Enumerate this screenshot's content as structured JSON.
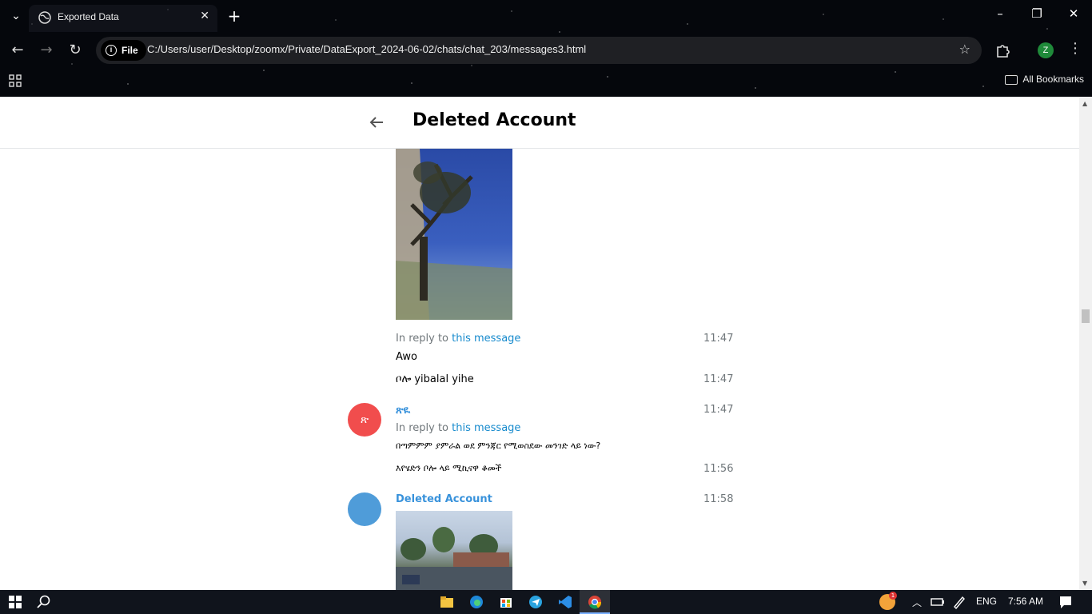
{
  "browser": {
    "tab_title": "Exported Data",
    "scheme_chip": "File",
    "url": "C:/Users/user/Desktop/zoomx/Private/DataExport_2024-06-02/chats/chat_203/messages3.html",
    "profile_initial": "Z",
    "bookmarks_label": "All Bookmarks"
  },
  "chat": {
    "title": "Deleted Account",
    "messages": [
      {
        "reply_prefix": "In reply to ",
        "reply_link": "this message",
        "time": "11:47",
        "text": "Awo"
      },
      {
        "time": "11:47",
        "text": "ቦሎ yibalal yihe"
      },
      {
        "avatar_letter": "ጽ",
        "sender": "ጽዪ",
        "time": "11:47",
        "reply_prefix": "In reply to ",
        "reply_link": "this message",
        "text": "በጣምምም ያምራል ወደ ምንጃር የሚወስደው መንገድ ላይ ነው?"
      },
      {
        "time": "11:56",
        "text": "እየሄድን ቦሎ ላይ ሚኪናዋ ቆመች"
      },
      {
        "sender": "Deleted Account",
        "time": "11:58"
      }
    ],
    "colors": {
      "avatar_red": "#f14d4d",
      "avatar_blue": "#4f9cd9",
      "link": "#168acd"
    }
  },
  "taskbar": {
    "language": "ENG",
    "clock": "7:56 AM",
    "notification_count": "1"
  }
}
